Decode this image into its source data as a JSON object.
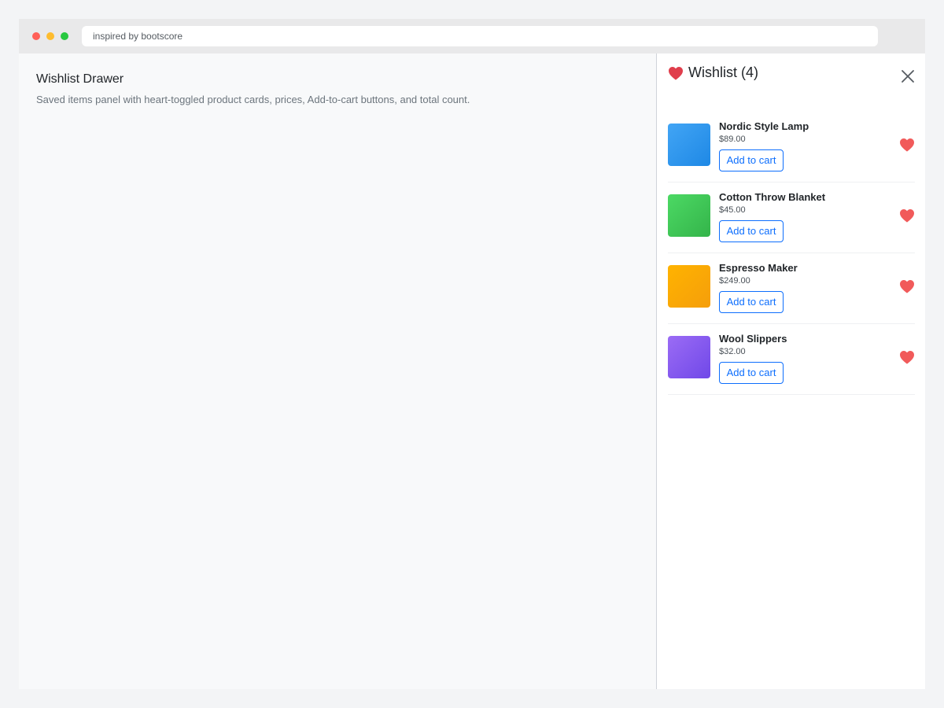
{
  "browser": {
    "address": "inspired by bootscore"
  },
  "page": {
    "title": "Wishlist Drawer",
    "description": "Saved items panel with heart-toggled product cards, prices, Add-to-cart buttons, and total count."
  },
  "drawer": {
    "title": "Wishlist (4)",
    "header_icon": "heart-icon",
    "close_icon": "close-icon",
    "items": [
      {
        "name": "Nordic Style Lamp",
        "price": "$89.00",
        "button": "Add to cart",
        "color_from": "#42a5f5",
        "color_to": "#1e88e5"
      },
      {
        "name": "Cotton Throw Blanket",
        "price": "$45.00",
        "button": "Add to cart",
        "color_from": "#4cd964",
        "color_to": "#34b44a"
      },
      {
        "name": "Espresso Maker",
        "price": "$249.00",
        "button": "Add to cart",
        "color_from": "#ffb300",
        "color_to": "#f59e0b"
      },
      {
        "name": "Wool Slippers",
        "price": "$32.00",
        "button": "Add to cart",
        "color_from": "#9b6cf5",
        "color_to": "#7048e8"
      }
    ]
  },
  "colors": {
    "accent": "#0d6efd",
    "heart": "#f15a5a",
    "header_heart": "#e03e4c"
  }
}
